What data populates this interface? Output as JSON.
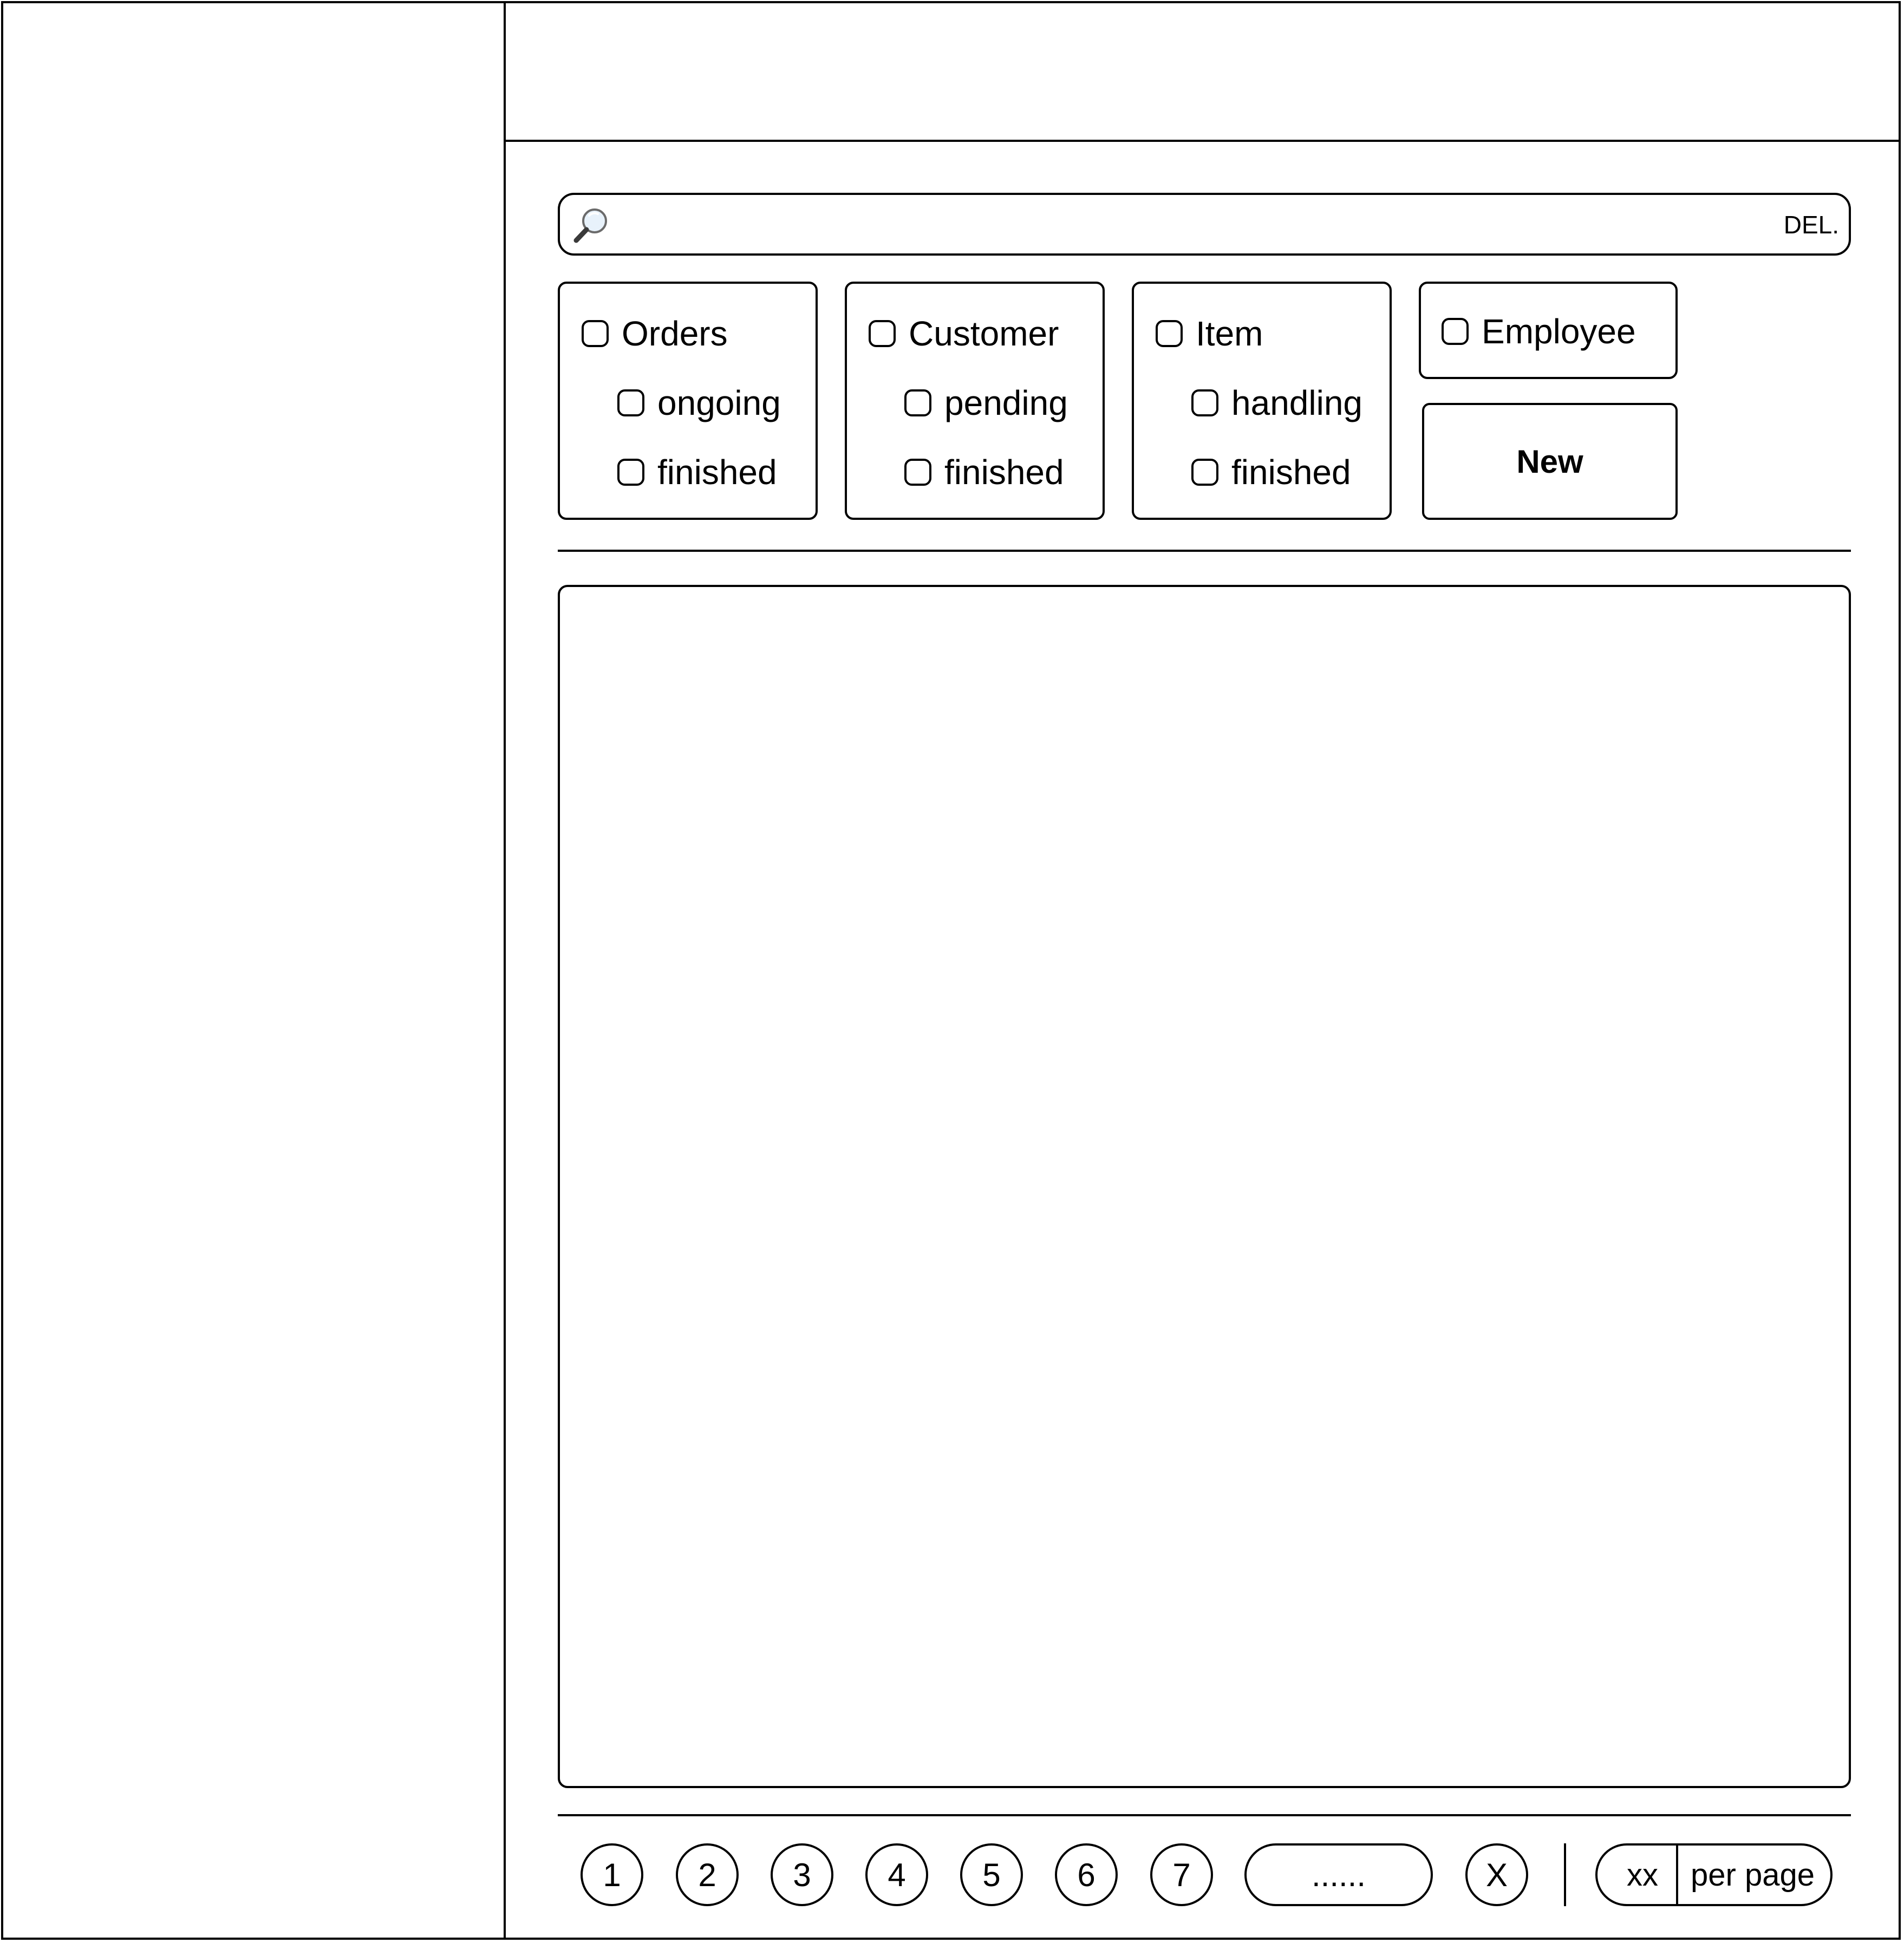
{
  "search": {
    "icon": "magnifier-icon",
    "value": "",
    "placeholder": "",
    "clear_label": "DEL."
  },
  "filters": {
    "orders": {
      "label": "Orders",
      "checked": false,
      "sub": [
        {
          "label": "ongoing",
          "checked": false
        },
        {
          "label": "finished",
          "checked": false
        }
      ]
    },
    "customer": {
      "label": "Customer",
      "checked": false,
      "sub": [
        {
          "label": "pending",
          "checked": false
        },
        {
          "label": "finished",
          "checked": false
        }
      ]
    },
    "item": {
      "label": "Item",
      "checked": false,
      "sub": [
        {
          "label": "handling",
          "checked": false
        },
        {
          "label": "finished",
          "checked": false
        }
      ]
    },
    "employee": {
      "label": "Employee",
      "checked": false
    }
  },
  "actions": {
    "new_label": "New"
  },
  "pagination": {
    "pages": [
      "1",
      "2",
      "3",
      "4",
      "5",
      "6",
      "7"
    ],
    "ellipsis": "......",
    "last": "X",
    "per_page_count": "xx",
    "per_page_label": "per page"
  }
}
